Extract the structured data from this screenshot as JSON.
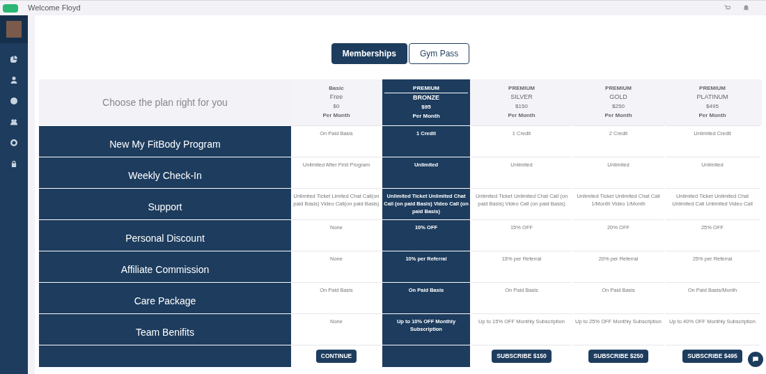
{
  "header": {
    "welcome": "Welcome Floyd"
  },
  "tabs": [
    {
      "label": "Memberships",
      "selected": true
    },
    {
      "label": "Gym Pass",
      "selected": false
    }
  ],
  "table": {
    "intro": "Choose the plan right for you",
    "plans": [
      {
        "tier": "Basic",
        "name": "Free",
        "price": "$0",
        "period": "Per Month",
        "highlighted": false,
        "button": "CONTINUE"
      },
      {
        "tier": "PREMIUM",
        "name": "BRONZE",
        "price": "$95",
        "period": "Per Month",
        "highlighted": true
      },
      {
        "tier": "PREMIUM",
        "name": "SILVER",
        "price": "$150",
        "period": "Per Month",
        "highlighted": false,
        "button": "SUBSCRIBE $150"
      },
      {
        "tier": "PREMIUM",
        "name": "GOLD",
        "price": "$250",
        "period": "Per Month",
        "highlighted": false,
        "button": "SUBSCRIBE $250"
      },
      {
        "tier": "PREMIUM",
        "name": "PLATINUM",
        "price": "$495",
        "period": "Per Month",
        "highlighted": false,
        "button": "SUBSCRIBE $495"
      }
    ],
    "features": [
      {
        "name": "New My FitBody Program",
        "values": [
          "On Paid Basis",
          "1 Credit",
          "1 Credit",
          "2 Credit",
          "Unlimited Credit"
        ]
      },
      {
        "name": "Weekly Check-In",
        "values": [
          "Unlimited After First Program",
          "Unlimited",
          "Unlimited",
          "Unlimited",
          "Unlimited"
        ]
      },
      {
        "name": "Support",
        "values": [
          "Unlimited Ticket Limited Chat Call(on paid Basis) Video Call(on paid Basis)",
          "Unlimited Ticket Unlimited Chat Call (on paid Basis) Video Call (on paid Basis)",
          "Unlimited Ticket Unlimited Chat Call (on paid Basis) Video Call (on paid Basis)",
          "Unlimited Ticket Unlimited Chat Call 1/Month Video 1/Month",
          "Unlimited Ticket Unlimited Chat Unlimited Call Unlimited Video Call"
        ]
      },
      {
        "name": "Personal Discount",
        "values": [
          "None",
          "10% OFF",
          "15% OFF",
          "20% OFF",
          "25% OFF"
        ]
      },
      {
        "name": "Affiliate Commission",
        "values": [
          "None",
          "10% per Referral",
          "15% per Referral",
          "20% per Referral",
          "25% per Referral"
        ]
      },
      {
        "name": "Care Package",
        "values": [
          "On Paid Basis",
          "On Paid Basis",
          "On Paid Basis",
          "On Paid Basis",
          "On Paid Basis/Month"
        ]
      },
      {
        "name": "Team Benifits",
        "values": [
          "None",
          "Up to 10% OFF Monthly Subscription",
          "Up to 15% OFF Monthly Subscription",
          "Up to 25% OFF Monthly Subscription",
          "Up to 40% OFF Monthly Subscription"
        ]
      }
    ]
  }
}
